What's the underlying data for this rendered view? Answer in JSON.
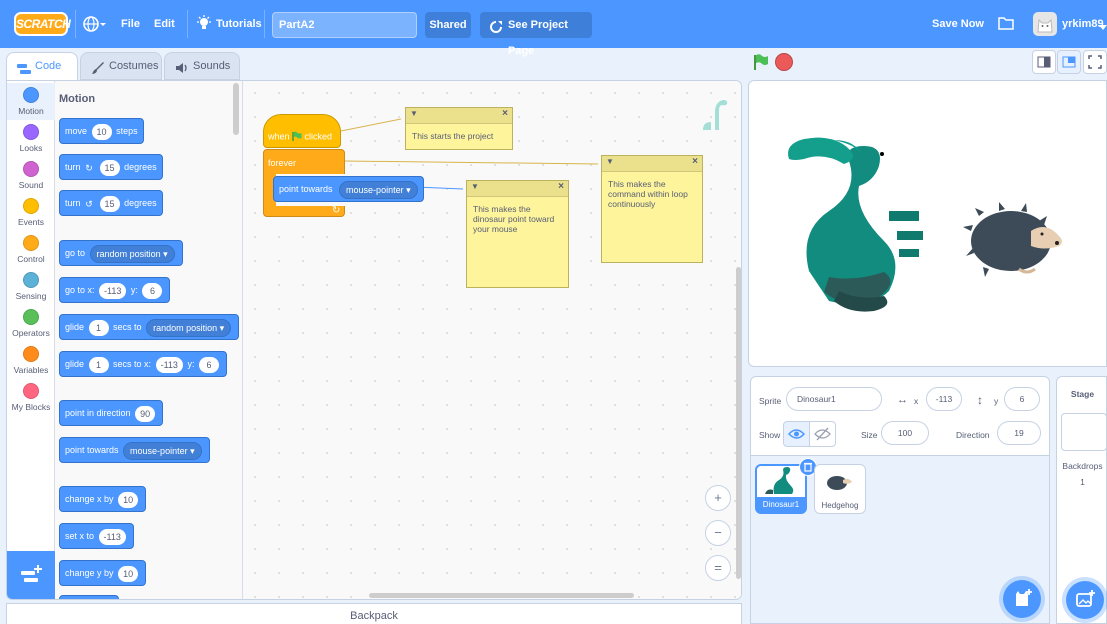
{
  "menubar": {
    "logo": "SCRATCH",
    "file": "File",
    "edit": "Edit",
    "tutorials": "Tutorials",
    "project_title": "PartA2",
    "shared": "Shared",
    "see_project": "See Project Page",
    "save_now": "Save Now",
    "username": "yrkim89"
  },
  "tabs": {
    "code": "Code",
    "costumes": "Costumes",
    "sounds": "Sounds"
  },
  "categories": [
    {
      "label": "Motion",
      "color": "#4c97ff"
    },
    {
      "label": "Looks",
      "color": "#9966ff"
    },
    {
      "label": "Sound",
      "color": "#cf63cf"
    },
    {
      "label": "Events",
      "color": "#ffbf00"
    },
    {
      "label": "Control",
      "color": "#ffab19"
    },
    {
      "label": "Sensing",
      "color": "#5cb1d6"
    },
    {
      "label": "Operators",
      "color": "#59c059"
    },
    {
      "label": "Variables",
      "color": "#ff8c1a"
    },
    {
      "label": "My Blocks",
      "color": "#ff6680"
    }
  ],
  "palette": {
    "title": "Motion",
    "move": {
      "pre": "move",
      "val": "10",
      "post": "steps"
    },
    "turn_right": {
      "pre": "turn",
      "val": "15",
      "post": "degrees"
    },
    "turn_left": {
      "pre": "turn",
      "val": "15",
      "post": "degrees"
    },
    "goto": {
      "pre": "go to",
      "dd": "random position"
    },
    "goto_xy": {
      "pre": "go to x:",
      "x": "-113",
      "ylbl": "y:",
      "y": "6"
    },
    "glide_to": {
      "pre": "glide",
      "val": "1",
      "mid": "secs to",
      "dd": "random position"
    },
    "glide_xy": {
      "pre": "glide",
      "val": "1",
      "mid": "secs to x:",
      "x": "-113",
      "ylbl": "y:",
      "y": "6"
    },
    "point_dir": {
      "pre": "point in direction",
      "val": "90"
    },
    "point_towards": {
      "pre": "point towards",
      "dd": "mouse-pointer"
    },
    "change_x": {
      "pre": "change x by",
      "val": "10"
    },
    "set_x": {
      "pre": "set x to",
      "val": "-113"
    },
    "change_y": {
      "pre": "change y by",
      "val": "10"
    }
  },
  "script": {
    "when": "when",
    "clicked": "clicked",
    "forever": "forever",
    "point_towards": "point towards",
    "target": "mouse-pointer"
  },
  "notes": {
    "n1": "This starts the project",
    "n2": "This makes the command within loop continuously",
    "n3": "This makes the dinosaur point toward your mouse"
  },
  "zoom": {
    "in": "+",
    "out": "−",
    "reset": "="
  },
  "backpack": "Backpack",
  "sprite": {
    "label": "Sprite",
    "name": "Dinosaur1",
    "x_label": "x",
    "x": "-113",
    "y_label": "y",
    "y": "6",
    "show_label": "Show",
    "size_label": "Size",
    "size": "100",
    "direction_label": "Direction",
    "direction": "19"
  },
  "sprites": [
    {
      "name": "Dinosaur1",
      "selected": true
    },
    {
      "name": "Hedgehog",
      "selected": false
    }
  ],
  "stage_pane": {
    "title": "Stage",
    "backdrops_label": "Backdrops",
    "backdrops_count": "1"
  },
  "colors": {
    "accent": "#4c97ff",
    "events": "#ffbf00",
    "control": "#ffab19",
    "note": "#fef49c"
  }
}
